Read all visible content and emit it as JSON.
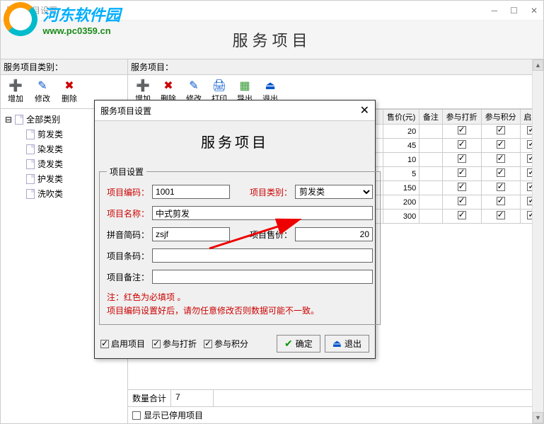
{
  "window": {
    "title": "服务项目设置"
  },
  "logo": {
    "cn": "河东软件园",
    "url": "www.pc0359.cn"
  },
  "header": {
    "title": "服务项目"
  },
  "left": {
    "panel_label": "服务项目类别：",
    "toolbar": [
      {
        "icon": "➕",
        "label": "增加",
        "color": "#3a7"
      },
      {
        "icon": "✎",
        "label": "修改",
        "color": "#05c"
      },
      {
        "icon": "✖",
        "label": "删除",
        "color": "#c00"
      }
    ],
    "tree": {
      "root": "全部类别",
      "children": [
        "剪发类",
        "染发类",
        "烫发类",
        "护发类",
        "洗吹类"
      ]
    }
  },
  "right": {
    "panel_label": "服务项目：",
    "toolbar": [
      {
        "icon": "➕",
        "label": "增加",
        "color": "#3a7"
      },
      {
        "icon": "✖",
        "label": "删除",
        "color": "#c00"
      },
      {
        "icon": "✎",
        "label": "修改",
        "color": "#05c"
      },
      {
        "icon": "🖨",
        "label": "打印",
        "color": "#05c"
      },
      {
        "icon": "▦",
        "label": "导出",
        "color": "#393"
      },
      {
        "icon": "⏏",
        "label": "退出",
        "color": "#05c"
      }
    ],
    "columns": [
      "售价(元)",
      "备注",
      "参与打折",
      "参与积分",
      "启用"
    ],
    "rows": [
      {
        "price": "20",
        "note": "",
        "discount": true,
        "points": true,
        "enabled": true
      },
      {
        "price": "45",
        "note": "",
        "discount": true,
        "points": true,
        "enabled": true
      },
      {
        "price": "10",
        "note": "",
        "discount": true,
        "points": true,
        "enabled": true
      },
      {
        "price": "5",
        "note": "",
        "discount": true,
        "points": true,
        "enabled": true
      },
      {
        "price": "150",
        "note": "",
        "discount": true,
        "points": true,
        "enabled": true
      },
      {
        "price": "200",
        "note": "",
        "discount": true,
        "points": true,
        "enabled": true
      },
      {
        "price": "300",
        "note": "",
        "discount": true,
        "points": true,
        "enabled": true
      }
    ],
    "footer": {
      "sum_label": "数量合计",
      "sum_value": "7",
      "show_disabled": "显示已停用项目"
    }
  },
  "dialog": {
    "title": "服务项目设置",
    "header": "服务项目",
    "fieldset_label": "项目设置",
    "fields": {
      "code_label": "项目编码：",
      "code_value": "1001",
      "cat_label": "项目类别：",
      "cat_value": "剪发类",
      "name_label": "项目名称：",
      "name_value": "中式剪发",
      "pinyin_label": "拼音简码：",
      "pinyin_value": "zsjf",
      "price_label": "项目售价：",
      "price_value": "20",
      "barcode_label": "项目条码：",
      "barcode_value": "",
      "remark_label": "项目备注：",
      "remark_value": ""
    },
    "note1": "注：红色为必填项 。",
    "note2": "      项目编码设置好后，请勿任意修改否则数据可能不一致。",
    "checkboxes": {
      "enable": "启用项目",
      "discount": "参与打折",
      "points": "参与积分"
    },
    "buttons": {
      "ok": "确定",
      "exit": "退出"
    }
  }
}
